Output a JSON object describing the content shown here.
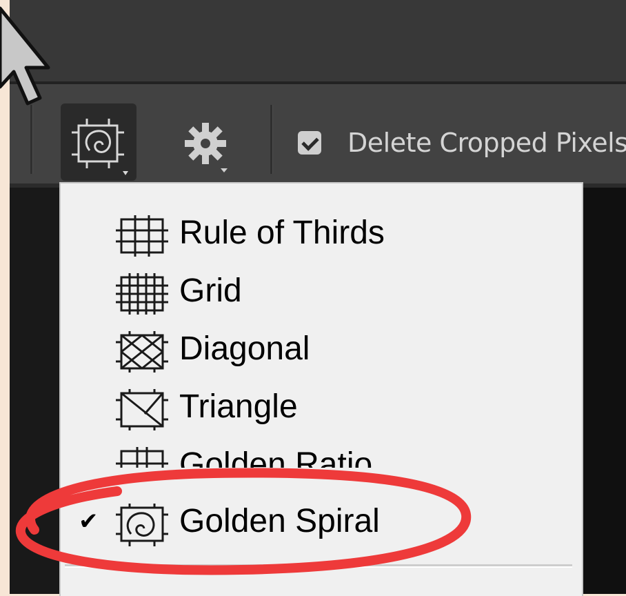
{
  "options_bar": {
    "overlay_button_icon": "golden-spiral-overlay-icon",
    "settings_button_icon": "gear-icon",
    "delete_cropped": {
      "checked": true,
      "label": "Delete Cropped Pixels"
    }
  },
  "overlay_menu": {
    "items": [
      {
        "label": "Rule of Thirds",
        "icon": "rule-of-thirds-icon",
        "checked": false
      },
      {
        "label": "Grid",
        "icon": "grid-icon",
        "checked": false
      },
      {
        "label": "Diagonal",
        "icon": "diagonal-icon",
        "checked": false
      },
      {
        "label": "Triangle",
        "icon": "triangle-icon",
        "checked": false
      },
      {
        "label": "Golden Ratio",
        "icon": "golden-ratio-icon",
        "checked": false
      },
      {
        "label": "Golden Spiral",
        "icon": "golden-spiral-icon",
        "checked": true
      }
    ],
    "check_glyph": "✔"
  },
  "colors": {
    "annotation": "#ee3a3a",
    "menu_background": "#f0f0f0",
    "toolbar_background": "#424242"
  }
}
